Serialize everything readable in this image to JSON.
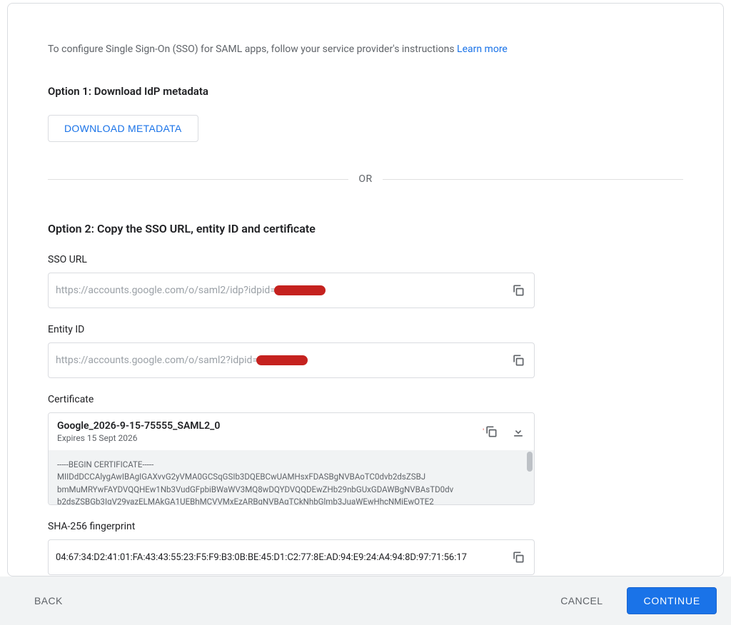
{
  "intro": {
    "text": "To configure Single Sign-On (SSO) for SAML apps, follow your service provider's instructions ",
    "learn_more": "Learn more"
  },
  "option1": {
    "heading": "Option 1: Download IdP metadata",
    "button": "DOWNLOAD METADATA"
  },
  "divider": "OR",
  "option2": {
    "heading": "Option 2: Copy the SSO URL, entity ID and certificate",
    "sso_url": {
      "label": "SSO URL",
      "value": "https://accounts.google.com/o/saml2/idp?idpid="
    },
    "entity_id": {
      "label": "Entity ID",
      "value": "https://accounts.google.com/o/saml2?idpid="
    },
    "certificate": {
      "label": "Certificate",
      "name": "Google_2026-9-15-75555_SAML2_0",
      "expires": "Expires 15 Sept 2026",
      "body_line1": "-----BEGIN CERTIFICATE-----",
      "body_line2": "MIIDdDCCAlygAwIBAgIGAXvvG2yVMA0GCSqGSIb3DQEBCwUAMHsxFDASBgNVBAoTC0dvb2dsZSBJ",
      "body_line3": "bmMuMRYwFAYDVQQHEw1Nb3VudGFpbiBWaWV3MQ8wDQYDVQQDEwZHb29nbGUxGDAWBgNVBAsTD0dv",
      "body_line4": "b2dsZSBGb3IgV29yazELMAkGA1UEBhMCVVMxEzARBgNVBAgTCkNhbGlmb3JuaWEwHhcNMjEwOTE2"
    },
    "fingerprint": {
      "label": "SHA-256 fingerprint",
      "value": "04:67:34:D2:41:01:FA:43:43:55:23:F5:F9:B3:0B:BE:45:D1:C2:77:8E:AD:94:E9:24:A4:94:8D:97:71:56:17"
    }
  },
  "footer": {
    "back": "BACK",
    "cancel": "CANCEL",
    "continue": "CONTINUE"
  }
}
